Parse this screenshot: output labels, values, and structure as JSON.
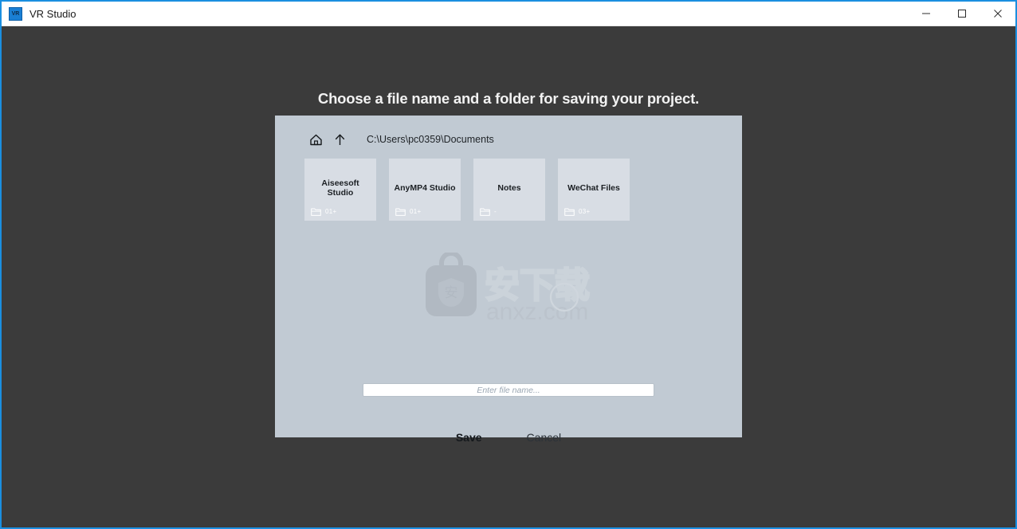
{
  "window": {
    "title": "VR Studio",
    "icon_label": "VR",
    "accent_color": "#1a8fe0",
    "background_color": "#3b3b3b",
    "controls": [
      {
        "name": "minimize",
        "glyph": "minimize-icon"
      },
      {
        "name": "maximize",
        "glyph": "maximize-icon"
      },
      {
        "name": "close",
        "glyph": "close-icon"
      }
    ]
  },
  "heading": "Choose a file name and a folder for saving your project.",
  "dialog": {
    "background_color": "#c1cad3",
    "path": "C:\\Users\\pc0359\\Documents",
    "nav": {
      "home_icon": "home-icon",
      "up_icon": "arrow-up-icon"
    },
    "folders": [
      {
        "name": "Aiseesoft Studio",
        "count": "01+",
        "icon": "folder-icon"
      },
      {
        "name": "AnyMP4 Studio",
        "count": "01+",
        "icon": "folder-icon"
      },
      {
        "name": "Notes",
        "count": "-",
        "icon": "folder-icon"
      },
      {
        "name": "WeChat Files",
        "count": "03+",
        "icon": "folder-icon"
      }
    ],
    "filename": {
      "value": "",
      "placeholder": "Enter file name..."
    },
    "buttons": {
      "save": "Save",
      "cancel": "Cancel"
    },
    "watermark": {
      "cn_text": "安下载",
      "url_text": "anxz.com",
      "logo_glyph": "安"
    }
  }
}
